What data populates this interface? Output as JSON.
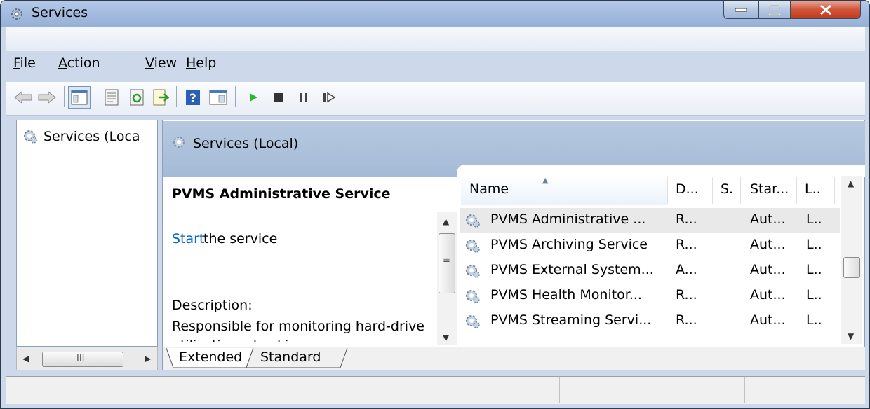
{
  "window": {
    "title": "Services",
    "icon": "gear-icon"
  },
  "menu": [
    {
      "label": "File",
      "accel": "F",
      "rest": "ile"
    },
    {
      "label": "Action",
      "accel": "A",
      "rest": "ction"
    },
    {
      "label": "View",
      "accel": "V",
      "rest": "iew"
    },
    {
      "label": "Help",
      "accel": "H",
      "rest": "elp"
    }
  ],
  "toolbar": {
    "icons": [
      "back-arrow-icon",
      "forward-arrow-icon",
      "show-hide-console-tree-icon",
      "properties-icon",
      "refresh-icon",
      "export-list-icon",
      "help-icon",
      "show-hide-action-pane-icon",
      "start-service-icon",
      "stop-service-icon",
      "pause-service-icon",
      "restart-service-icon"
    ]
  },
  "tree": {
    "root_label": "Services (Loca"
  },
  "panel": {
    "header_title": "Services (Local)",
    "selected_service": "PVMS Administrative Service",
    "start_link": "Start",
    "start_rest": "the service",
    "description_label": "Description:",
    "description_text": "Responsible for monitoring hard-drive utilization, checking"
  },
  "table": {
    "columns": [
      "Name",
      "D...",
      "S.",
      "Star...",
      "L.."
    ],
    "rows": [
      {
        "name": "PVMS Administrative ...",
        "desc": "R...",
        "status": "",
        "startup": "Aut...",
        "logon": "L.."
      },
      {
        "name": "PVMS Archiving Service",
        "desc": "R...",
        "status": "",
        "startup": "Aut...",
        "logon": "L.."
      },
      {
        "name": "PVMS External System...",
        "desc": "A...",
        "status": "",
        "startup": "Aut...",
        "logon": "L.."
      },
      {
        "name": "PVMS Health Monitor...",
        "desc": "R...",
        "status": "",
        "startup": "Aut...",
        "logon": "L.."
      },
      {
        "name": "PVMS Streaming Servi...",
        "desc": "R...",
        "status": "",
        "startup": "Aut...",
        "logon": "L.."
      }
    ]
  },
  "tabs": [
    "Extended",
    "Standard"
  ],
  "hscroll_label": "III",
  "colors": {
    "link": "#0066cc",
    "header_bg": "#a5bad7",
    "close_red": "#c23a1c"
  }
}
